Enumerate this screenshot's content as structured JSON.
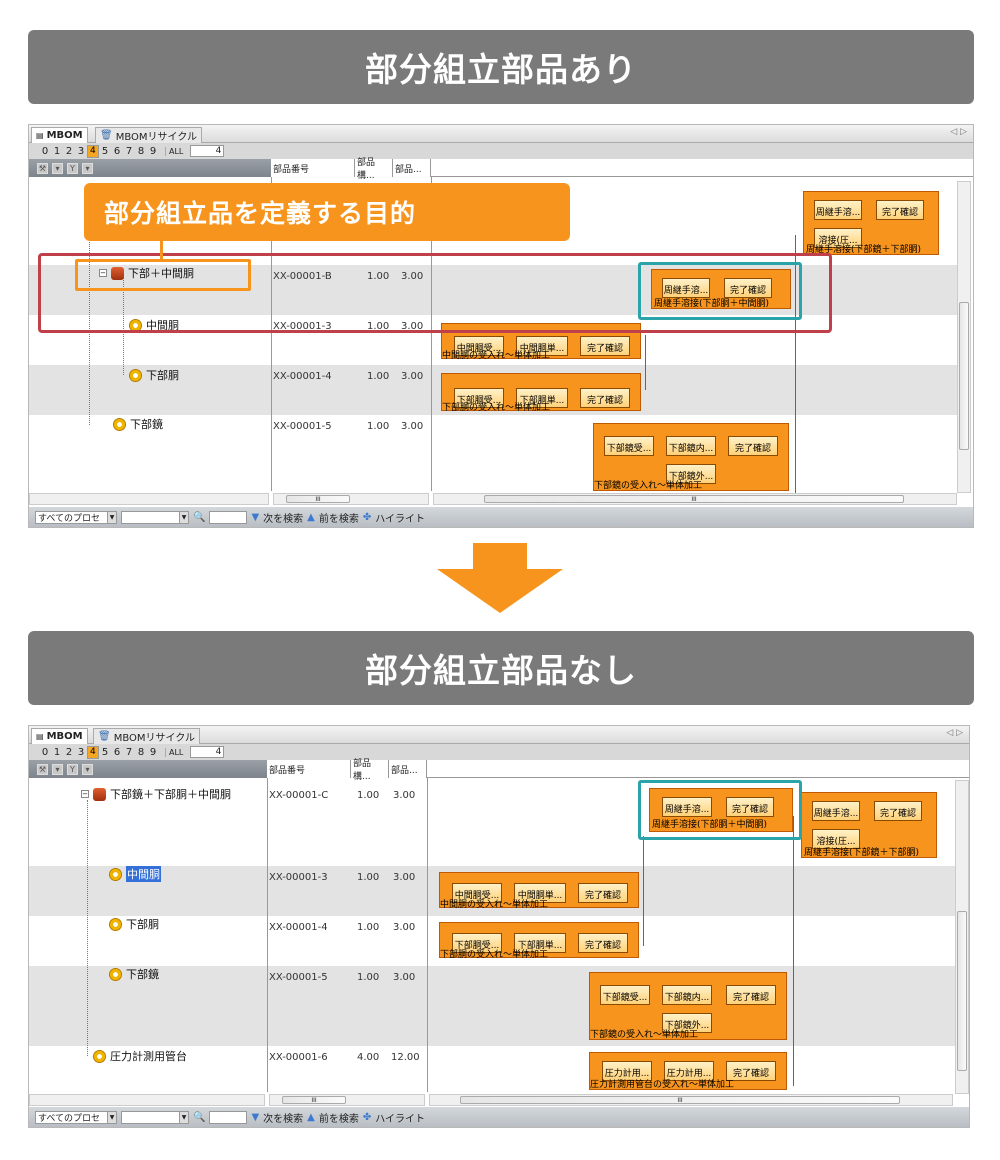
{
  "banner_top": "部分組立部品あり",
  "banner_bottom": "部分組立部品なし",
  "callout": "部分組立品を定義する目的",
  "tabs": {
    "mbom": "MBOM",
    "recycle": "MBOMリサイクル"
  },
  "levels": [
    "0",
    "1",
    "2",
    "3",
    "4",
    "5",
    "6",
    "7",
    "8",
    "9"
  ],
  "level_selected": "4",
  "level_all": "ALL",
  "level_input": "4",
  "columns": {
    "part_no": "部品番号",
    "part_qty": "部品構...",
    "part_cost": "部品..."
  },
  "top": {
    "rows": [
      {
        "name": "下部＋中間胴",
        "part": "XX-00001-B",
        "qty": "1.00",
        "val": "3.00"
      },
      {
        "name": "中間胴",
        "part": "XX-00001-3",
        "qty": "1.00",
        "val": "3.00"
      },
      {
        "name": "下部胴",
        "part": "XX-00001-4",
        "qty": "1.00",
        "val": "3.00"
      },
      {
        "name": "下部鏡",
        "part": "XX-00001-5",
        "qty": "1.00",
        "val": "3.00"
      }
    ],
    "flows": {
      "f1": {
        "b1": "周継手溶...",
        "b2": "完了確認",
        "b3": "溶接(圧...",
        "label": "周継手溶接(下部鏡＋下部胴)"
      },
      "f2": {
        "b1": "周継手溶...",
        "b2": "完了確認",
        "label": "周継手溶接(下部胴＋中間胴)"
      },
      "f3": {
        "b1": "中間胴受...",
        "b2": "中間胴単...",
        "b3": "完了確認",
        "label": "中間胴の受入れ～単体加工"
      },
      "f4": {
        "b1": "下部胴受...",
        "b2": "下部胴単...",
        "b3": "完了確認",
        "label": "下部胴の受入れ～単体加工"
      },
      "f5": {
        "b1": "下部鏡受...",
        "b2": "下部鏡内...",
        "b3": "完了確認",
        "b4": "下部鏡外...",
        "label": "下部鏡の受入れ～単体加工"
      }
    }
  },
  "bottom": {
    "rows": [
      {
        "name": "下部鏡＋下部胴＋中間胴",
        "part": "XX-00001-C",
        "qty": "1.00",
        "val": "3.00"
      },
      {
        "name": "中間胴",
        "part": "XX-00001-3",
        "qty": "1.00",
        "val": "3.00"
      },
      {
        "name": "下部胴",
        "part": "XX-00001-4",
        "qty": "1.00",
        "val": "3.00"
      },
      {
        "name": "下部鏡",
        "part": "XX-00001-5",
        "qty": "1.00",
        "val": "3.00"
      },
      {
        "name": "圧力計測用管台",
        "part": "XX-00001-6",
        "qty": "4.00",
        "val": "12.00"
      }
    ],
    "flows": {
      "f1": {
        "b1": "周継手溶...",
        "b2": "完了確認",
        "label": "周継手溶接(下部胴＋中間胴)"
      },
      "f2": {
        "b1": "周継手溶...",
        "b2": "完了確認",
        "b3": "溶接(圧...",
        "label": "周継手溶接(下部鏡＋下部胴)"
      },
      "f3": {
        "b1": "中間胴受...",
        "b2": "中間胴単...",
        "b3": "完了確認",
        "label": "中間胴の受入れ～単体加工"
      },
      "f4": {
        "b1": "下部胴受...",
        "b2": "下部胴単...",
        "b3": "完了確認",
        "label": "下部胴の受入れ～単体加工"
      },
      "f5": {
        "b1": "下部鏡受...",
        "b2": "下部鏡内...",
        "b3": "完了確認",
        "b4": "下部鏡外...",
        "label": "下部鏡の受入れ～単体加工"
      },
      "f6": {
        "b1": "圧力計用...",
        "b2": "圧力計用...",
        "b3": "完了確認",
        "label": "圧力計測用管台の受入れ～単体加工"
      }
    }
  },
  "search": {
    "process": "すべてのプロセ",
    "next": "次を検索",
    "prev": "前を検索",
    "highlight": "ハイライト"
  },
  "scroll_mark": "III",
  "colors": {
    "banner": "#7a7a7a",
    "accent": "#f7941d",
    "red": "#c0404a",
    "teal": "#2aa3a9"
  }
}
